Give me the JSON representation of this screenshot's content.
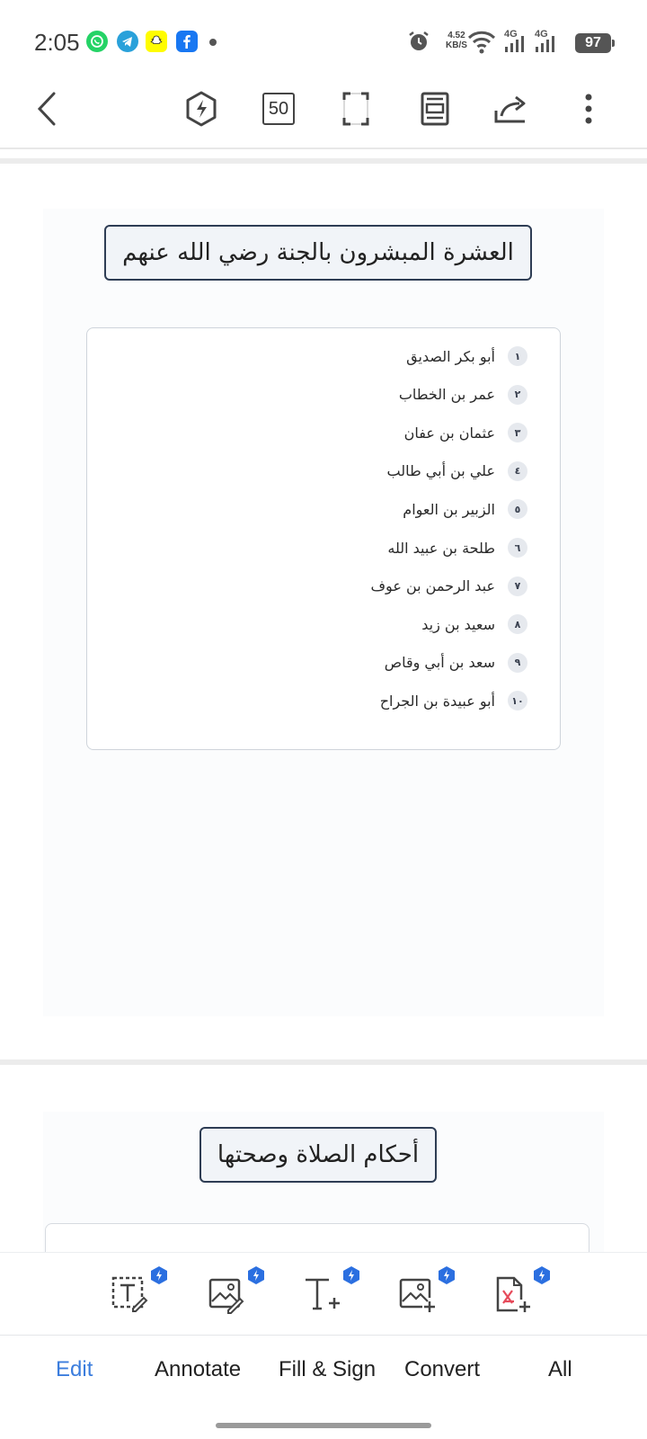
{
  "status_bar": {
    "time": "2:05",
    "net_speed_value": "4.52",
    "net_speed_unit": "KB/S",
    "signal1": "4G",
    "signal2": "4G",
    "battery": "97",
    "notification_apps": [
      "whatsapp-icon",
      "telegram-icon",
      "snapchat-icon",
      "facebook-icon"
    ]
  },
  "toolbar": {
    "zoom": "50",
    "icons": [
      "back-arrow-icon",
      "power-mode-icon",
      "zoom-level",
      "fullscreen-icon",
      "page-layout-icon",
      "share-icon",
      "more-options-icon"
    ]
  },
  "page1": {
    "title": "العشرة المبشرون بالجنة رضي الله عنهم",
    "items": [
      {
        "num": "١",
        "name": "أبو بكر الصديق"
      },
      {
        "num": "٢",
        "name": "عمر بن الخطاب"
      },
      {
        "num": "٣",
        "name": "عثمان بن عفان"
      },
      {
        "num": "٤",
        "name": "علي بن أبي طالب"
      },
      {
        "num": "٥",
        "name": "الزبير بن العوام"
      },
      {
        "num": "٦",
        "name": "طلحة بن عبيد الله"
      },
      {
        "num": "٧",
        "name": "عبد الرحمن بن عوف"
      },
      {
        "num": "٨",
        "name": "سعيد بن زيد"
      },
      {
        "num": "٩",
        "name": "سعد بن أبي وقاص"
      },
      {
        "num": "١٠",
        "name": "أبو عبيدة بن الجراح"
      }
    ]
  },
  "page2": {
    "title": "أحكام الصلاة وصحتها"
  },
  "tools": [
    "edit-text-icon",
    "edit-image-icon",
    "add-text-icon",
    "add-image-icon",
    "pdf-convert-icon"
  ],
  "tabs": {
    "edit": "Edit",
    "annotate": "Annotate",
    "fill_sign": "Fill & Sign",
    "convert": "Convert",
    "all": "All"
  },
  "colors": {
    "accent": "#3b7ddd",
    "pro_badge": "#2b6fe0",
    "title_border": "#2e3d54"
  }
}
